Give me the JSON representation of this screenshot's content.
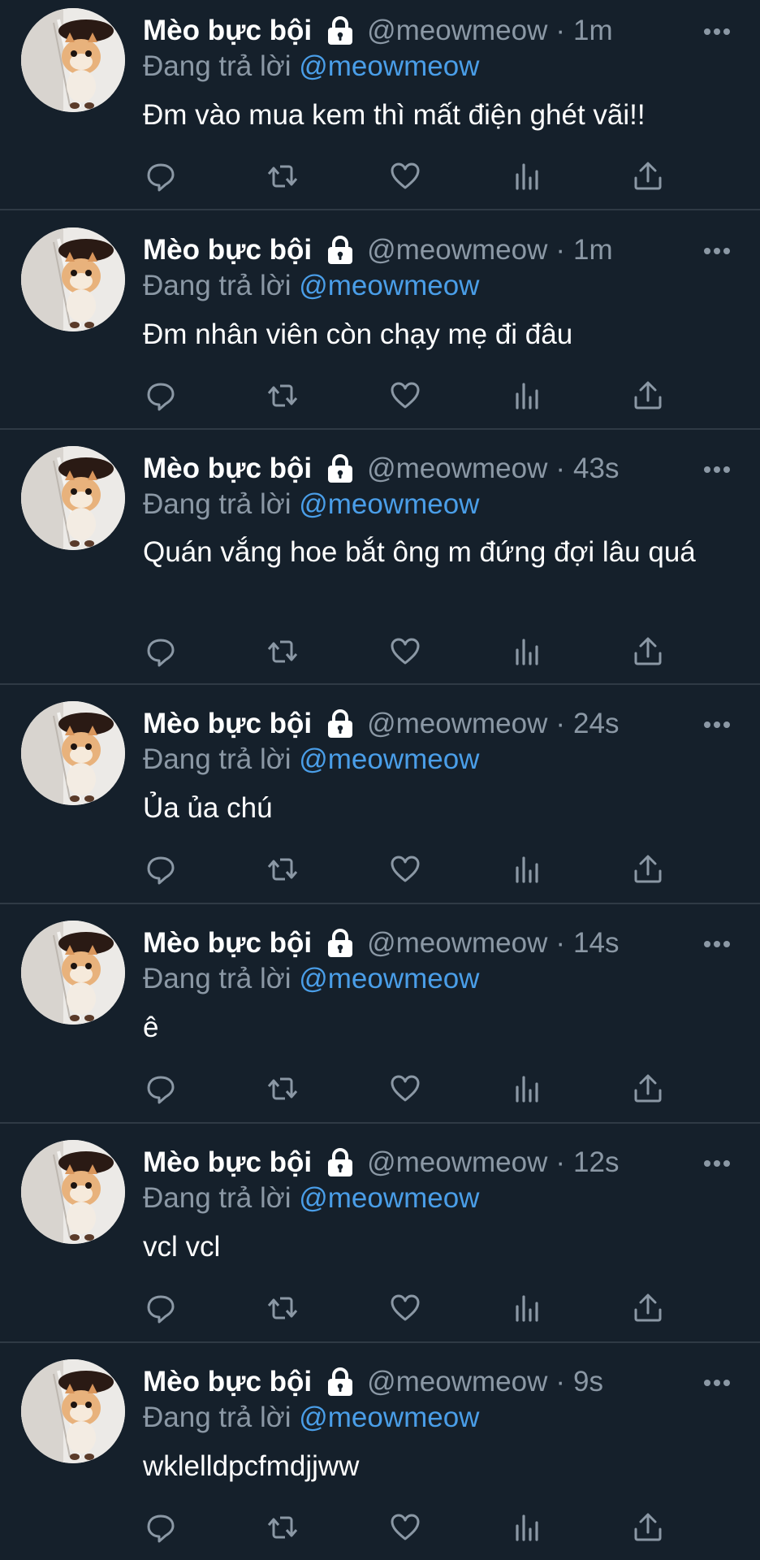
{
  "colors": {
    "background": "#15202b",
    "divider": "#2f3a45",
    "secondary_text": "#8b98a5",
    "link": "#4a9ee8",
    "primary_text": "#ffffff"
  },
  "tweets": [
    {
      "name": "Mèo bực bội",
      "handle": "@meowmeow",
      "separator": "·",
      "time": "1m",
      "reply_prefix": "Đang trả lời",
      "reply_to": "@meowmeow",
      "text": "Đm vào mua kem thì mất điện ghét vãi!!"
    },
    {
      "name": "Mèo bực bội",
      "handle": "@meowmeow",
      "separator": "·",
      "time": "1m",
      "reply_prefix": "Đang trả lời",
      "reply_to": "@meowmeow",
      "text": "Đm nhân viên còn chạy mẹ đi đâu"
    },
    {
      "name": "Mèo bực bội",
      "handle": "@meowmeow",
      "separator": "·",
      "time": "43s",
      "reply_prefix": "Đang trả lời",
      "reply_to": "@meowmeow",
      "text": "Quán vắng hoe bắt ông m đứng đợi lâu quá"
    },
    {
      "name": "Mèo bực bội",
      "handle": "@meowmeow",
      "separator": "·",
      "time": "24s",
      "reply_prefix": "Đang trả lời",
      "reply_to": "@meowmeow",
      "text": "Ủa ủa chú"
    },
    {
      "name": "Mèo bực bội",
      "handle": "@meowmeow",
      "separator": "·",
      "time": "14s",
      "reply_prefix": "Đang trả lời",
      "reply_to": "@meowmeow",
      "text": "ê"
    },
    {
      "name": "Mèo bực bội",
      "handle": "@meowmeow",
      "separator": "·",
      "time": "12s",
      "reply_prefix": "Đang trả lời",
      "reply_to": "@meowmeow",
      "text": "vcl vcl"
    },
    {
      "name": "Mèo bực bội",
      "handle": "@meowmeow",
      "separator": "·",
      "time": "9s",
      "reply_prefix": "Đang trả lời",
      "reply_to": "@meowmeow",
      "text": "wklelldpcfmdjjww"
    }
  ],
  "icons": {
    "avatar": "cat-avatar",
    "lock": "lock-icon",
    "more": "more-icon",
    "actions": [
      "reply-icon",
      "retweet-icon",
      "like-icon",
      "views-icon",
      "share-icon"
    ]
  }
}
